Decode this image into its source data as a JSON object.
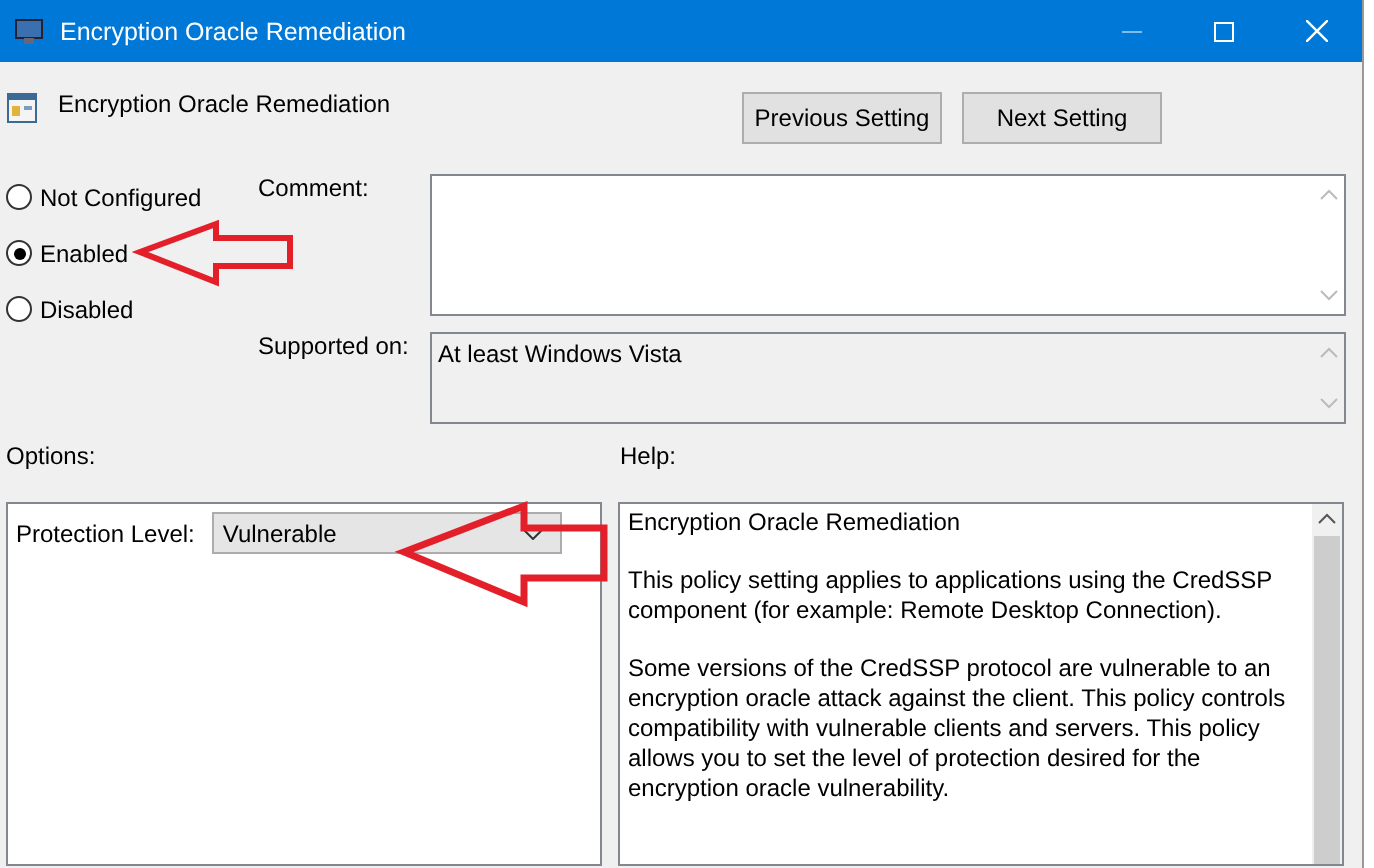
{
  "window": {
    "title": "Encryption Oracle Remediation"
  },
  "header": {
    "title": "Encryption Oracle Remediation"
  },
  "nav_buttons": [
    "Previous Setting",
    "Next Setting"
  ],
  "state_options": [
    {
      "label": "Not Configured",
      "selected": false
    },
    {
      "label": "Enabled",
      "selected": true
    },
    {
      "label": "Disabled",
      "selected": false
    }
  ],
  "comment": {
    "label": "Comment:"
  },
  "supported_on": {
    "label": "Supported on:",
    "value": "At least Windows Vista"
  },
  "options": {
    "label": "Options:",
    "fields": [
      {
        "label": "Protection Level:",
        "value": "Vulnerable"
      }
    ]
  },
  "help": {
    "label": "Help:",
    "paragraphs": [
      "Encryption Oracle Remediation",
      "This policy setting applies to applications using the CredSSP component (for example: Remote Desktop Connection).",
      "Some versions of the CredSSP protocol are vulnerable to an encryption oracle attack against the client.  This policy controls compatibility with vulnerable clients and servers.  This policy allows you to set the level of protection desired for the encryption oracle vulnerability."
    ]
  }
}
